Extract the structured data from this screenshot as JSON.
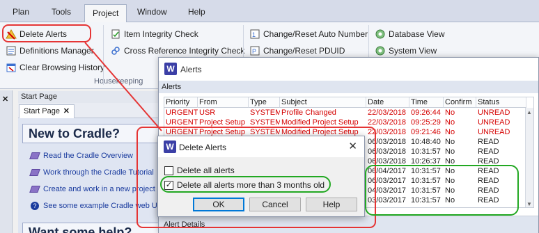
{
  "menu": {
    "items": [
      "Plan",
      "Tools",
      "Project",
      "Window",
      "Help"
    ],
    "active": "Project"
  },
  "ribbon": {
    "housekeeping": {
      "delete_alerts": "Delete Alerts",
      "definitions_manager": "Definitions Manager",
      "clear_history": "Clear Browsing History",
      "label": "Housekeeping"
    },
    "checks": {
      "item_integrity": "Item Integrity Check",
      "cross_ref_integrity": "Cross Reference Integrity Check"
    },
    "reset": {
      "auto_number": "Change/Reset Auto Number",
      "pduid": "Change/Reset PDUID"
    },
    "database": {
      "database_view": "Database View",
      "system_view": "System View"
    }
  },
  "start_page": {
    "panel_title": "Start Page",
    "tab_label": "Start Page",
    "new_heading": "New to Cradle?",
    "links": [
      "Read the Cradle Overview",
      "Work through the Cradle Tutorial",
      "Create and work in a new project",
      "See some example Cradle web UIs"
    ],
    "help_heading": "Want some help?"
  },
  "alerts_window": {
    "logo": "W",
    "title": "Alerts",
    "section_label": "Alerts",
    "columns": [
      "Priority",
      "From",
      "Type",
      "Subject",
      "Date",
      "Time",
      "Confirm",
      "Status"
    ],
    "rows": [
      {
        "priority": "URGENT",
        "from": "USR",
        "type": "SYSTEM",
        "subject": "Profile Changed",
        "date": "22/03/2018",
        "time": "09:26:44",
        "confirm": "No",
        "status": "UNREAD",
        "urgent": true
      },
      {
        "priority": "URGENT",
        "from": "Project Setup",
        "type": "SYSTEM",
        "subject": "Modified Project Setup",
        "date": "22/03/2018",
        "time": "09:25:29",
        "confirm": "No",
        "status": "UNREAD",
        "urgent": true
      },
      {
        "priority": "URGENT",
        "from": "Project Setup",
        "type": "SYSTEM",
        "subject": "Modified Project Setup",
        "date": "22/03/2018",
        "time": "09:21:46",
        "confirm": "No",
        "status": "UNREAD",
        "urgent": true
      },
      {
        "priority": "",
        "from": "",
        "type": "",
        "subject": "",
        "date": "06/03/2018",
        "time": "10:48:40",
        "confirm": "No",
        "status": "READ",
        "urgent": false
      },
      {
        "priority": "",
        "from": "",
        "type": "",
        "subject": "",
        "date": "06/03/2018",
        "time": "10:31:57",
        "confirm": "No",
        "status": "READ",
        "urgent": false
      },
      {
        "priority": "",
        "from": "",
        "type": "",
        "subject": "",
        "date": "06/03/2018",
        "time": "10:26:37",
        "confirm": "No",
        "status": "READ",
        "urgent": false
      },
      {
        "priority": "",
        "from": "",
        "type": "",
        "subject": "",
        "date": "06/04/2017",
        "time": "10:31:57",
        "confirm": "No",
        "status": "READ",
        "urgent": false
      },
      {
        "priority": "",
        "from": "",
        "type": "",
        "subject": "",
        "date": "06/03/2017",
        "time": "10:31:57",
        "confirm": "No",
        "status": "READ",
        "urgent": false
      },
      {
        "priority": "",
        "from": "",
        "type": "",
        "subject": "",
        "date": "04/03/2017",
        "time": "10:31:57",
        "confirm": "No",
        "status": "READ",
        "urgent": false
      },
      {
        "priority": "",
        "from": "",
        "type": "",
        "subject": "",
        "date": "03/03/2017",
        "time": "10:31:57",
        "confirm": "No",
        "status": "READ",
        "urgent": false
      }
    ],
    "details_label": "Alert Details"
  },
  "delete_dialog": {
    "logo": "W",
    "title": "Delete Alerts",
    "close_glyph": "✕",
    "option_all": "Delete all alerts",
    "option_all_checked": false,
    "option_old": "Delete all alerts more than 3 months old",
    "option_old_checked": true,
    "check_glyph": "✓",
    "ok": "OK",
    "cancel": "Cancel",
    "help": "Help"
  },
  "colors": {
    "urgent": "#d40000",
    "highlight_red": "#e53535",
    "highlight_green": "#22a822",
    "accent": "#3b3fa6"
  }
}
